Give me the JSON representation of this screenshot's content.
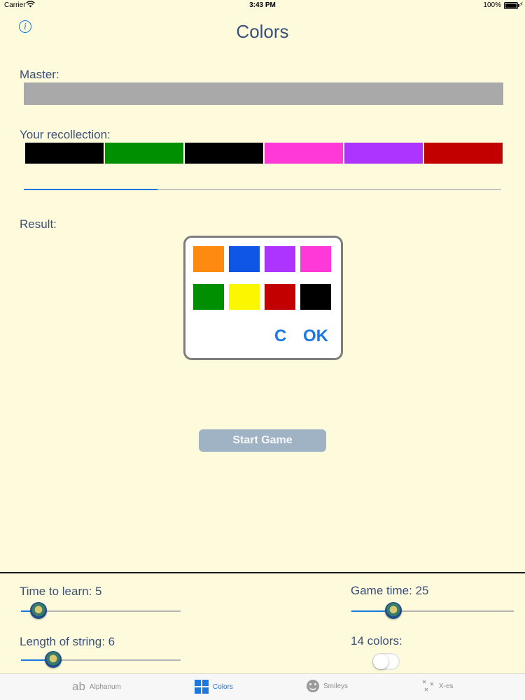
{
  "status_bar": {
    "carrier": "Carrier",
    "time": "3:43 PM",
    "battery": "100%"
  },
  "header": {
    "title": "Colors",
    "info_icon": "info-icon"
  },
  "labels": {
    "master": "Master:",
    "recollection": "Your recollection:",
    "result": "Result:"
  },
  "master": {
    "color": "#a9a9a9"
  },
  "recollection": {
    "colors": [
      "#000000",
      "#008f00",
      "#000000",
      "#ff38d8",
      "#ad33ff",
      "#c20000"
    ]
  },
  "progress": {
    "value": 0.28
  },
  "palette": {
    "colors": [
      "#ff8a12",
      "#0f55e6",
      "#ad33ff",
      "#ff38d8",
      "#008f00",
      "#fbf700",
      "#c20000",
      "#000000"
    ],
    "clear_label": "C",
    "ok_label": "OK"
  },
  "start_button": {
    "label": "Start Game"
  },
  "settings": {
    "time_to_learn": {
      "label": "Time to learn: 5",
      "value": 5,
      "fraction": 0.11
    },
    "game_time": {
      "label": "Game time: 25",
      "value": 25,
      "fraction": 0.26
    },
    "length_of_string": {
      "label": "Length of string: 6",
      "value": 6,
      "fraction": 0.2
    },
    "colors_toggle": {
      "label": "14 colors:",
      "on": false
    }
  },
  "tabs": [
    {
      "label": "Alphanum",
      "icon": "ab-icon",
      "glyph": "ab"
    },
    {
      "label": "Colors",
      "icon": "grid-icon"
    },
    {
      "label": "Smileys",
      "icon": "smiley-icon"
    },
    {
      "label": "X-es",
      "icon": "xes-icon"
    }
  ]
}
